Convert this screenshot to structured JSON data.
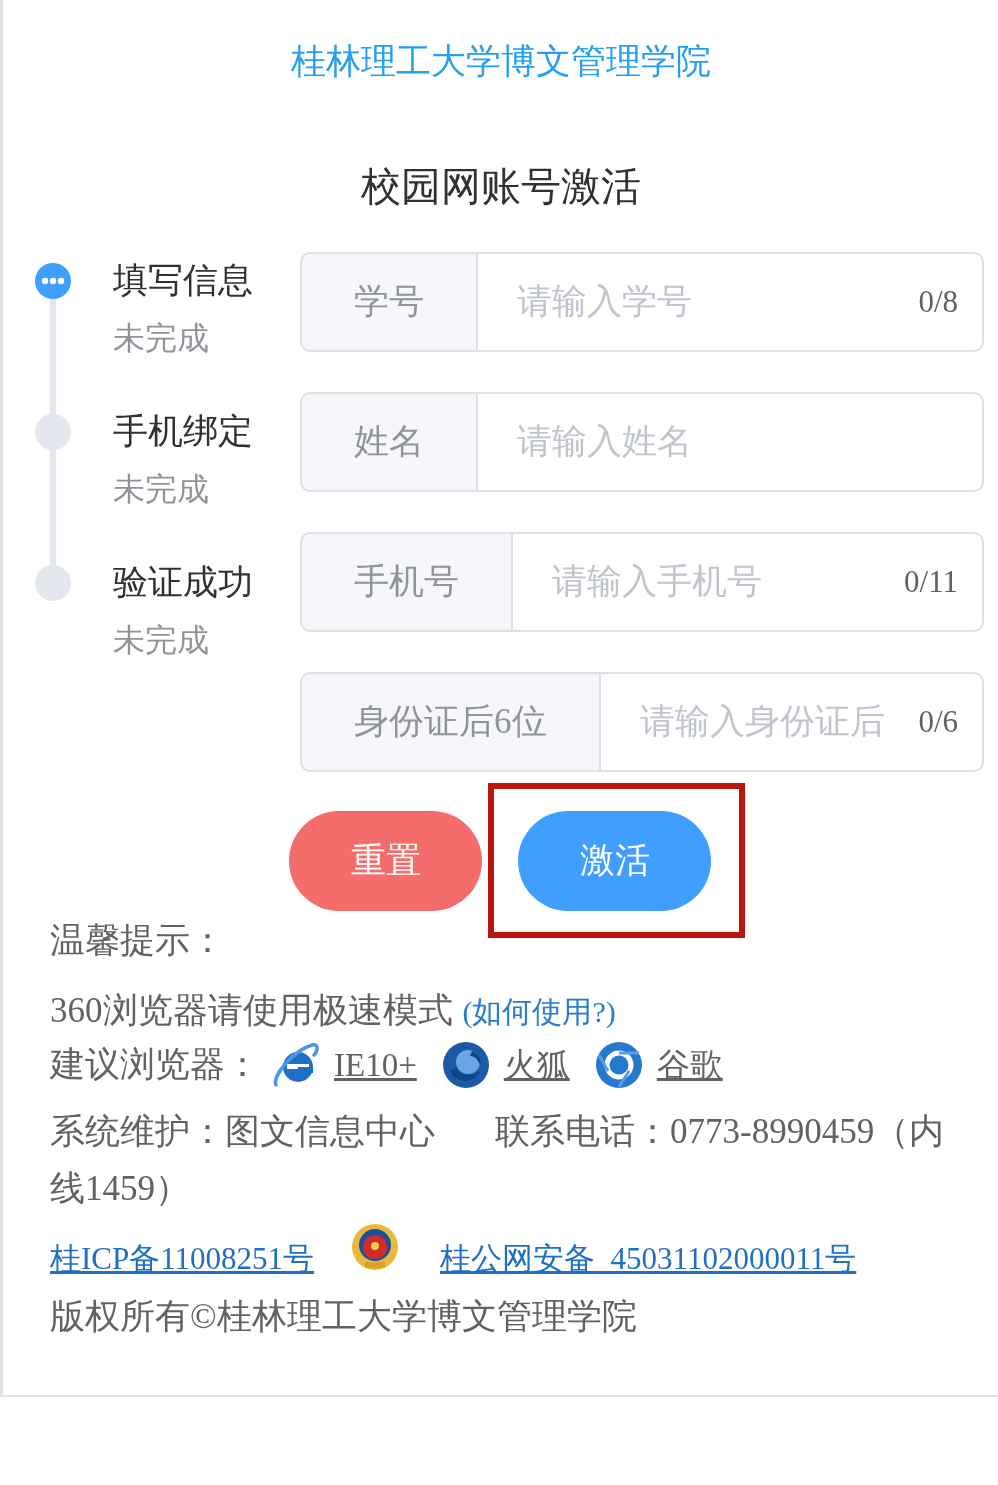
{
  "header": {
    "school_name": "桂林理工大学博文管理学院",
    "page_title": "校园网账号激活"
  },
  "steps": [
    {
      "title": "填写信息",
      "status": "未完成",
      "active": true
    },
    {
      "title": "手机绑定",
      "status": "未完成",
      "active": false
    },
    {
      "title": "验证成功",
      "status": "未完成",
      "active": false
    }
  ],
  "form": {
    "fields": [
      {
        "label": "学号",
        "placeholder": "请输入学号",
        "counter": "0/8"
      },
      {
        "label": "姓名",
        "placeholder": "请输入姓名"
      },
      {
        "label": "手机号",
        "placeholder": "请输入手机号",
        "counter": "0/11"
      },
      {
        "label": "身份证后6位",
        "placeholder": "请输入身份证后",
        "counter": "0/6"
      }
    ],
    "buttons": [
      {
        "label": "重置",
        "kind": "reset",
        "highlighted": false
      },
      {
        "label": "激活",
        "kind": "submit",
        "highlighted": true
      }
    ]
  },
  "tips": {
    "heading": "温馨提示：",
    "speed_mode_note": "360浏览器请使用极速模式",
    "how_to_link": "(如何使用?)",
    "browsers_label": "建议浏览器：",
    "browsers": [
      {
        "name": "IE10+",
        "kind": "orbit"
      },
      {
        "name": "火狐",
        "kind": "swirl"
      },
      {
        "name": "谷歌",
        "kind": "ring"
      }
    ],
    "maintenance": "系统维护：图文信息中心",
    "contact": "联系电话：0773-8990459（内线1459）"
  },
  "footer": {
    "icp_link": "桂ICP备11008251号",
    "police_record_link": "桂公网安备  45031102000011号",
    "copyright": "版权所有©桂林理工大学博文管理学院"
  }
}
